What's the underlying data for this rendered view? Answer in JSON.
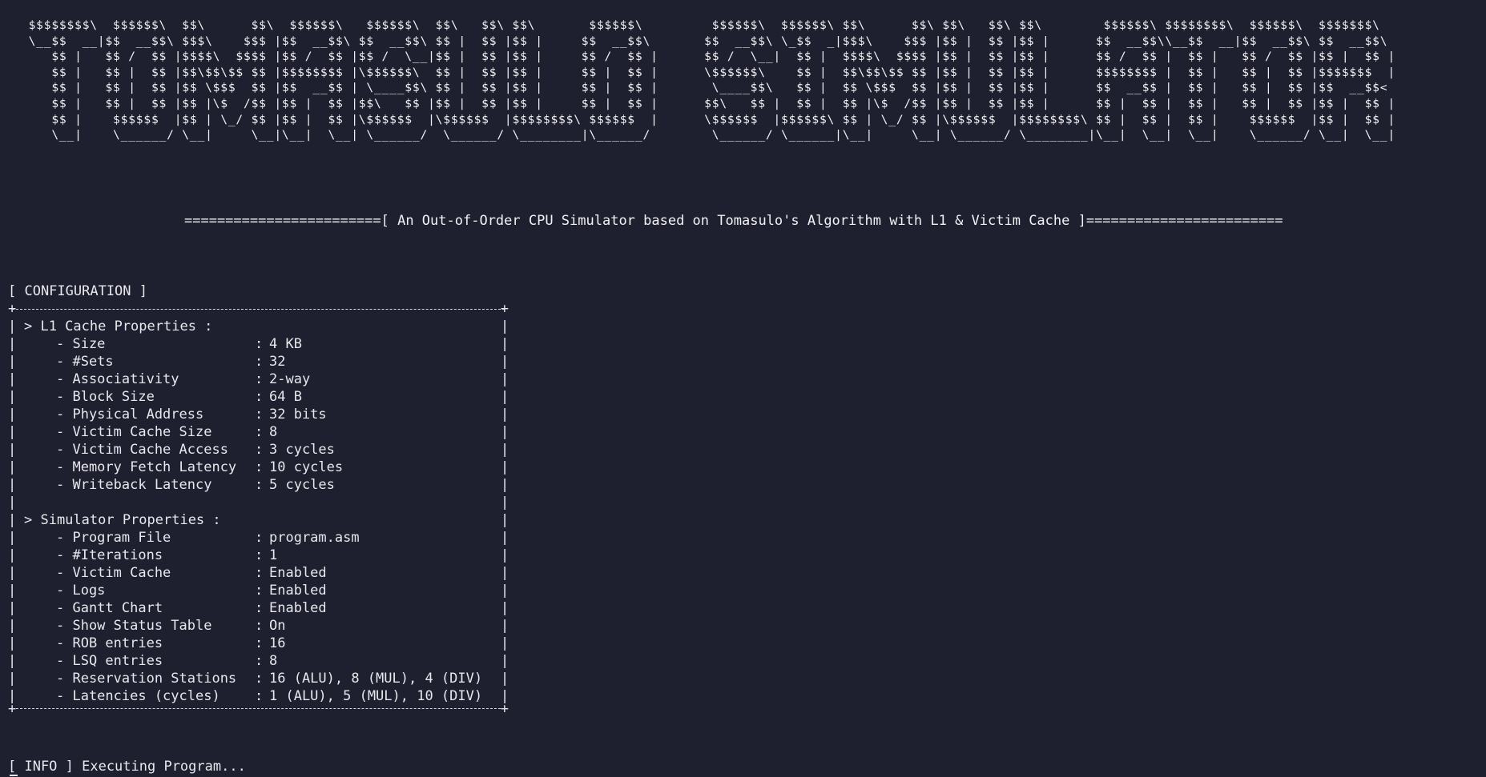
{
  "banner": {
    "ascii_lines": [
      " $$$$$$$$\\  $$$$$$\\  $$\\      $$\\  $$$$$$\\   $$$$$$\\  $$\\   $$\\ $$\\       $$$$$$\\         $$$$$$\\  $$$$$$\\ $$\\      $$\\ $$\\   $$\\ $$\\        $$$$$$\\ $$$$$$$$\\  $$$$$$\\  $$$$$$$\\ ",
      " \\__$$  __|$$  __$$\\ $$$\\    $$$ |$$  __$$\\ $$  __$$\\ $$ |  $$ |$$ |     $$  __$$\\       $$  __$$\\ \\_$$  _|$$$\\    $$$ |$$ |  $$ |$$ |      $$  __$$\\\\__$$  __|$$  __$$\\ $$  __$$\\",
      "    $$ |   $$ /  $$ |$$$$\\  $$$$ |$$ /  $$ |$$ /  \\__|$$ |  $$ |$$ |     $$ /  $$ |      $$ /  \\__|  $$ |  $$$$\\  $$$$ |$$ |  $$ |$$ |      $$ /  $$ |  $$ |   $$ /  $$ |$$ |  $$ |",
      "    $$ |   $$ |  $$ |$$\\$$\\$$ $$ |$$$$$$$$ |\\$$$$$$\\  $$ |  $$ |$$ |     $$ |  $$ |      \\$$$$$$\\    $$ |  $$\\$$\\$$ $$ |$$ |  $$ |$$ |      $$$$$$$$ |  $$ |   $$ |  $$ |$$$$$$$  |",
      "    $$ |   $$ |  $$ |$$ \\$$$  $$ |$$  __$$ | \\____$$\\ $$ |  $$ |$$ |     $$ |  $$ |       \\____$$\\   $$ |  $$ \\$$$  $$ |$$ |  $$ |$$ |      $$  __$$ |  $$ |   $$ |  $$ |$$  __$$<",
      "    $$ |   $$ |  $$ |$$ |\\$  /$$ |$$ |  $$ |$$\\   $$ |$$ |  $$ |$$ |     $$ |  $$ |      $$\\   $$ |  $$ |  $$ |\\$  /$$ |$$ |  $$ |$$ |      $$ |  $$ |  $$ |   $$ |  $$ |$$ |  $$ |",
      "    $$ |    $$$$$$  |$$ | \\_/ $$ |$$ |  $$ |\\$$$$$$  |\\$$$$$$  |$$$$$$$$\\ $$$$$$  |      \\$$$$$$  |$$$$$$\\ $$ | \\_/ $$ |\\$$$$$$  |$$$$$$$$\\ $$ |  $$ |  $$ |    $$$$$$  |$$ |  $$ |",
      "    \\__|    \\______/ \\__|     \\__|\\__|  \\__| \\______/  \\______/ \\________|\\______/        \\______/ \\______|\\__|     \\__| \\______/ \\________|\\__|  \\__|  \\__|    \\______/ \\__|  \\__|"
    ]
  },
  "subtitle": "========================[ An Out-of-Order CPU Simulator based on Tomasulo's Algorithm with L1 & Victim Cache ]========================",
  "config": {
    "header": "[ CONFIGURATION ]",
    "l1_title": "> L1 Cache Properties :",
    "l1_items": [
      {
        "key": "- Size",
        "value": "4 KB"
      },
      {
        "key": "- #Sets",
        "value": "32"
      },
      {
        "key": "- Associativity",
        "value": "2-way"
      },
      {
        "key": "- Block Size",
        "value": "64 B"
      },
      {
        "key": "- Physical Address",
        "value": "32 bits"
      },
      {
        "key": "- Victim Cache Size",
        "value": "8"
      },
      {
        "key": "- Victim Cache Access",
        "value": "3 cycles"
      },
      {
        "key": "- Memory Fetch Latency",
        "value": "10 cycles"
      },
      {
        "key": "- Writeback Latency",
        "value": "5 cycles"
      }
    ],
    "sim_title": "> Simulator Properties :",
    "sim_items": [
      {
        "key": "- Program File",
        "value": "program.asm"
      },
      {
        "key": "- #Iterations",
        "value": "1"
      },
      {
        "key": "- Victim Cache",
        "value": "Enabled"
      },
      {
        "key": "- Logs",
        "value": "Enabled"
      },
      {
        "key": "- Gantt Chart",
        "value": "Enabled"
      },
      {
        "key": "- Show Status Table",
        "value": "On"
      },
      {
        "key": "- ROB entries",
        "value": "16"
      },
      {
        "key": "- LSQ entries",
        "value": "8"
      },
      {
        "key": "- Reservation Stations",
        "value": "16 (ALU), 8 (MUL), 4 (DIV)"
      },
      {
        "key": "- Latencies (cycles)",
        "value": "1 (ALU), 5 (MUL), 10 (DIV)"
      }
    ]
  },
  "info": "[ INFO ] Executing Program...",
  "colors": {
    "background": "#1e1f2f",
    "foreground": "#e8e8ec"
  }
}
